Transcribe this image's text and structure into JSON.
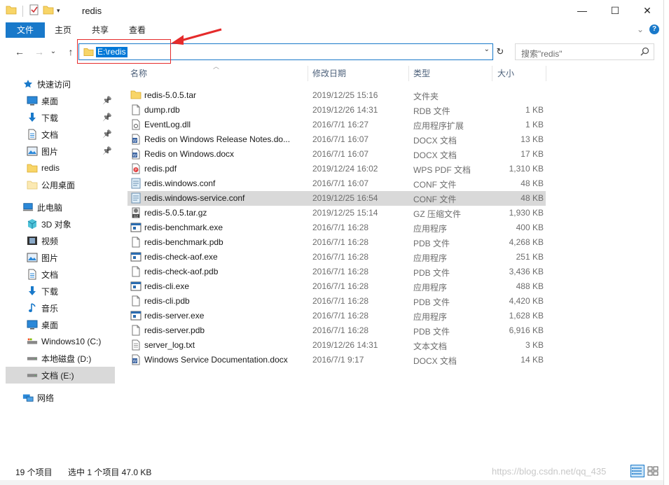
{
  "window": {
    "title": "redis",
    "minimize": "—",
    "maximize": "☐",
    "close": "✕"
  },
  "ribbon": {
    "tabs": [
      "文件",
      "主页",
      "共享",
      "查看"
    ],
    "expand": "⌄",
    "help": "?"
  },
  "navigation": {
    "back": "←",
    "forward": "→",
    "recent": "⌄",
    "up": "↑",
    "address": "E:\\redis",
    "address_dropdown": "⌄",
    "refresh": "↻",
    "search_placeholder": "搜索\"redis\""
  },
  "columns": {
    "name": "名称",
    "date": "修改日期",
    "type": "类型",
    "size": "大小"
  },
  "sidebar": {
    "items": [
      {
        "label": "快速访问",
        "icon": "star-icon",
        "indent": 1,
        "pinned": false
      },
      {
        "label": "桌面",
        "icon": "desktop-icon",
        "indent": 2,
        "pinned": true
      },
      {
        "label": "下载",
        "icon": "download-icon",
        "indent": 2,
        "pinned": true
      },
      {
        "label": "文档",
        "icon": "document-icon",
        "indent": 2,
        "pinned": true
      },
      {
        "label": "图片",
        "icon": "picture-icon",
        "indent": 2,
        "pinned": true
      },
      {
        "label": "redis",
        "icon": "folder-icon",
        "indent": 2,
        "pinned": false
      },
      {
        "label": "公用桌面",
        "icon": "folder-light-icon",
        "indent": 2,
        "pinned": false
      },
      {
        "label": "此电脑",
        "icon": "computer-icon",
        "indent": 1,
        "pinned": false
      },
      {
        "label": "3D 对象",
        "icon": "cube-icon",
        "indent": 2,
        "pinned": false
      },
      {
        "label": "视频",
        "icon": "film-icon",
        "indent": 2,
        "pinned": false
      },
      {
        "label": "图片",
        "icon": "picture-icon",
        "indent": 2,
        "pinned": false
      },
      {
        "label": "文档",
        "icon": "document-icon",
        "indent": 2,
        "pinned": false
      },
      {
        "label": "下载",
        "icon": "download-icon",
        "indent": 2,
        "pinned": false
      },
      {
        "label": "音乐",
        "icon": "music-icon",
        "indent": 2,
        "pinned": false
      },
      {
        "label": "桌面",
        "icon": "desktop-icon",
        "indent": 2,
        "pinned": false
      },
      {
        "label": "Windows10 (C:)",
        "icon": "system-drive-icon",
        "indent": 2,
        "pinned": false
      },
      {
        "label": "本地磁盘 (D:)",
        "icon": "drive-icon",
        "indent": 2,
        "pinned": false
      },
      {
        "label": "文档 (E:)",
        "icon": "drive-icon",
        "indent": 2,
        "pinned": false,
        "selected": true
      },
      {
        "label": "网络",
        "icon": "network-icon",
        "indent": 1,
        "pinned": false
      }
    ]
  },
  "files": [
    {
      "name": "redis-5.0.5.tar",
      "date": "2019/12/25 15:16",
      "type": "文件夹",
      "size": "",
      "icon": "folder-icon"
    },
    {
      "name": "dump.rdb",
      "date": "2019/12/26 14:31",
      "type": "RDB 文件",
      "size": "1 KB",
      "icon": "file-icon"
    },
    {
      "name": "EventLog.dll",
      "date": "2016/7/1 16:27",
      "type": "应用程序扩展",
      "size": "1 KB",
      "icon": "dll-icon"
    },
    {
      "name": "Redis on Windows Release Notes.do...",
      "date": "2016/7/1 16:07",
      "type": "DOCX 文档",
      "size": "13 KB",
      "icon": "word-icon"
    },
    {
      "name": "Redis on Windows.docx",
      "date": "2016/7/1 16:07",
      "type": "DOCX 文档",
      "size": "17 KB",
      "icon": "word-icon"
    },
    {
      "name": "redis.pdf",
      "date": "2019/12/24 16:02",
      "type": "WPS PDF 文档",
      "size": "1,310 KB",
      "icon": "pdf-icon"
    },
    {
      "name": "redis.windows.conf",
      "date": "2016/7/1 16:07",
      "type": "CONF 文件",
      "size": "48 KB",
      "icon": "conf-icon"
    },
    {
      "name": "redis.windows-service.conf",
      "date": "2019/12/25 16:54",
      "type": "CONF 文件",
      "size": "48 KB",
      "icon": "conf-icon",
      "selected": true
    },
    {
      "name": "redis-5.0.5.tar.gz",
      "date": "2019/12/25 15:14",
      "type": "GZ 压缩文件",
      "size": "1,930 KB",
      "icon": "archive-icon"
    },
    {
      "name": "redis-benchmark.exe",
      "date": "2016/7/1 16:28",
      "type": "应用程序",
      "size": "400 KB",
      "icon": "exe-icon"
    },
    {
      "name": "redis-benchmark.pdb",
      "date": "2016/7/1 16:28",
      "type": "PDB 文件",
      "size": "4,268 KB",
      "icon": "file-icon"
    },
    {
      "name": "redis-check-aof.exe",
      "date": "2016/7/1 16:28",
      "type": "应用程序",
      "size": "251 KB",
      "icon": "exe-icon"
    },
    {
      "name": "redis-check-aof.pdb",
      "date": "2016/7/1 16:28",
      "type": "PDB 文件",
      "size": "3,436 KB",
      "icon": "file-icon"
    },
    {
      "name": "redis-cli.exe",
      "date": "2016/7/1 16:28",
      "type": "应用程序",
      "size": "488 KB",
      "icon": "exe-icon"
    },
    {
      "name": "redis-cli.pdb",
      "date": "2016/7/1 16:28",
      "type": "PDB 文件",
      "size": "4,420 KB",
      "icon": "file-icon"
    },
    {
      "name": "redis-server.exe",
      "date": "2016/7/1 16:28",
      "type": "应用程序",
      "size": "1,628 KB",
      "icon": "exe-icon"
    },
    {
      "name": "redis-server.pdb",
      "date": "2016/7/1 16:28",
      "type": "PDB 文件",
      "size": "6,916 KB",
      "icon": "file-icon"
    },
    {
      "name": "server_log.txt",
      "date": "2019/12/26 14:31",
      "type": "文本文档",
      "size": "3 KB",
      "icon": "text-icon"
    },
    {
      "name": "Windows Service Documentation.docx",
      "date": "2016/7/1 9:17",
      "type": "DOCX 文档",
      "size": "14 KB",
      "icon": "word-icon"
    }
  ],
  "status": {
    "item_count": "19 个项目",
    "selection": "选中 1 个项目  47.0 KB"
  },
  "watermark": "https://blog.csdn.net/qq_435",
  "colors": {
    "accent": "#1979ca",
    "selection": "#d9d9d9",
    "address_highlight": "#0078d7",
    "annotation": "#e52b2b",
    "folder": "#f8d568"
  }
}
